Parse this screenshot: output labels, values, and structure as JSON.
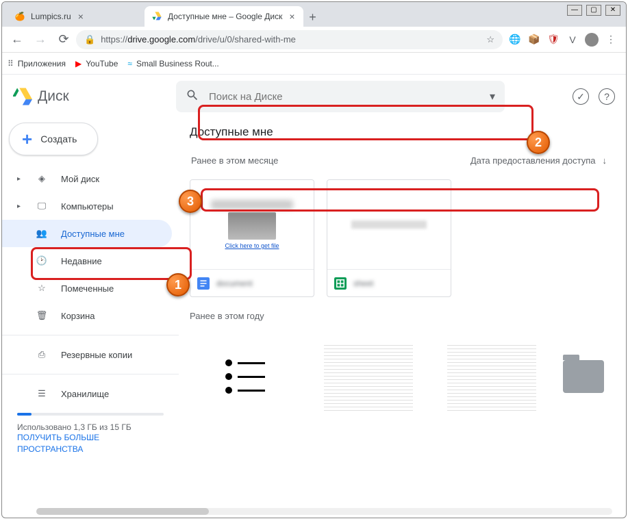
{
  "window": {
    "min": "—",
    "max": "▢",
    "close": "✕"
  },
  "tabs": [
    {
      "title": "Lumpics.ru",
      "favicon": "🍊"
    },
    {
      "title": "Доступные мне – Google Диск",
      "favicon": "drive"
    }
  ],
  "newtab": "+",
  "nav": {
    "back": "←",
    "forward": "→",
    "reload": "⟳"
  },
  "url": {
    "lock": "🔒",
    "proto": "https://",
    "host": "drive.google.com",
    "path": "/drive/u/0/shared-with-me",
    "star": "☆"
  },
  "ext": [
    "🌐",
    "📦",
    "🛡",
    "V",
    "⋮"
  ],
  "bookmarks": [
    {
      "icon": "⠿",
      "label": "Приложения"
    },
    {
      "icon": "▶",
      "label": "YouTube"
    },
    {
      "icon": "≈",
      "label": "Small Business Rout..."
    }
  ],
  "drive": {
    "logo_text": "Диск",
    "search_placeholder": "Поиск на Диске",
    "header_icons": {
      "ready": "✓",
      "help": "?"
    }
  },
  "create_label": "Создать",
  "sidebar": {
    "items": [
      {
        "icon": "◈",
        "label": "Мой диск",
        "expandable": true
      },
      {
        "icon": "🖵",
        "label": "Компьютеры",
        "expandable": true
      },
      {
        "icon": "👥",
        "label": "Доступные мне",
        "active": true
      },
      {
        "icon": "🕑",
        "label": "Недавние"
      },
      {
        "icon": "☆",
        "label": "Помеченные"
      },
      {
        "icon": "🗑",
        "label": "Корзина"
      }
    ],
    "backups": {
      "icon": "⎙",
      "label": "Резервные копии"
    },
    "storage": {
      "icon": "☰",
      "label": "Хранилище",
      "used_text": "Использовано 1,3 ГБ из 15 ГБ",
      "link": "ПОЛУЧИТЬ БОЛЬШЕ ПРОСТРАНСТВА"
    }
  },
  "content": {
    "title": "Доступные мне",
    "section1": "Ранее в этом месяце",
    "sort_label": "Дата предоставления доступа",
    "sort_arrow": "↓",
    "file1": {
      "preview_link": "Click here to get file",
      "name": "document"
    },
    "file2": {
      "name": "sheet"
    },
    "section2": "Ранее в этом году"
  },
  "annotations": {
    "n1": "1",
    "n2": "2",
    "n3": "3"
  }
}
